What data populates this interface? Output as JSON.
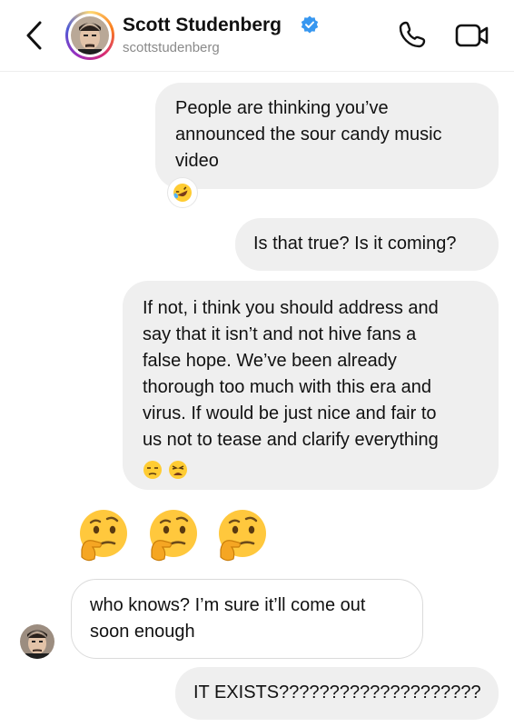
{
  "header": {
    "name": "Scott Studenberg",
    "username": "scottstudenberg",
    "verified_color": "#3797f0"
  },
  "messages": [
    {
      "from": "me",
      "lines": [
        "People are thinking you’ve",
        "announced the sour candy music",
        "video"
      ],
      "reaction": "rolling-on-floor-laughing-emoji"
    },
    {
      "from": "me",
      "lines": [
        "Is that true? Is it coming?"
      ]
    },
    {
      "from": "me",
      "lines": [
        "If not, i think you should address and",
        "say that it isn’t and not hive fans a",
        "false hope. We’ve been already",
        "thorough too much with this era and",
        "virus. If would be just nice and fair to",
        "us not to tease and clarify everything"
      ],
      "trailing_emojis": [
        "unamused-face-emoji",
        "weary-face-emoji"
      ]
    },
    {
      "from": "me",
      "emoji_only": [
        "thinking-face-emoji",
        "thinking-face-emoji",
        "thinking-face-emoji"
      ]
    },
    {
      "from": "them",
      "lines": [
        "who knows? I’m sure it’ll come out",
        "soon enough"
      ]
    },
    {
      "from": "me",
      "lines": [
        "IT EXISTS????????????????????"
      ]
    }
  ]
}
